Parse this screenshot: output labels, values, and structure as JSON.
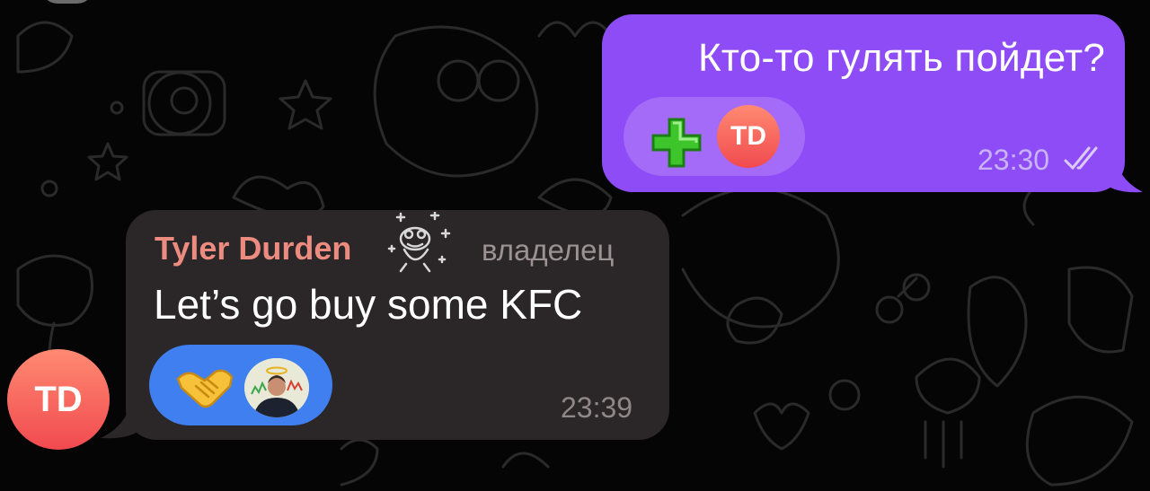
{
  "outgoing_message": {
    "text": "Кто-то гулять пойдет?",
    "time": "23:30",
    "status_icon": "double-check-icon",
    "reaction": {
      "emoji_icon": "plus-emoji-icon",
      "avatar_initials": "TD"
    }
  },
  "incoming_message": {
    "sender_name": "Tyler Durden",
    "sender_badge_icon": "frog-emoji-status-icon",
    "role": "владелец",
    "text": "Let’s go buy some KFC",
    "time": "23:39",
    "reaction": {
      "emoji_icon": "handshake-emoji-icon",
      "avatar_icon": "user-photo-avatar"
    },
    "sender_avatar_initials": "TD"
  },
  "colors": {
    "background": "#050505",
    "outgoing_bubble": "#8e4cf6",
    "incoming_bubble": "#2b2627",
    "sender_name": "#ec8b80",
    "reaction_incoming": "#3f7ff0",
    "avatar_gradient": [
      "#ff8a72",
      "#f14a4f"
    ]
  }
}
